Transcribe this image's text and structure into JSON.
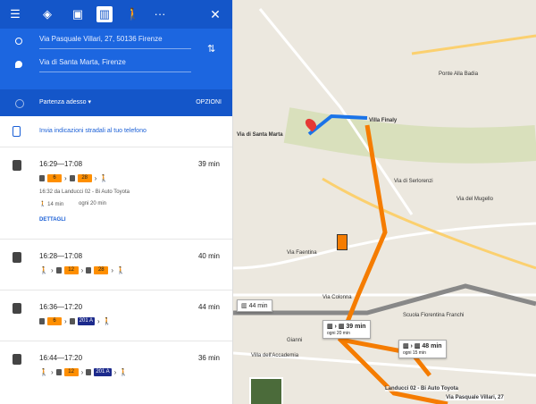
{
  "form": {
    "origin": "Via Pasquale Villari, 27, 50136 Firenze",
    "destination": "Via di Santa Marta, Firenze",
    "departure": "Partenza adesso",
    "options": "OPZIONI"
  },
  "send_to_phone": "Invia indicazioni stradali al tuo telefono",
  "routes": [
    {
      "time": "16:29—17:08",
      "duration": "39 min",
      "lines": [
        "6",
        "28"
      ],
      "details_stop": "16:32 da Landucci 02 - Bi Auto Toyota",
      "walk": "14 min",
      "every": "ogni 20 min",
      "details_link": "DETTAGLI"
    },
    {
      "time": "16:28—17:08",
      "duration": "40 min",
      "lines": [
        "12",
        "28"
      ]
    },
    {
      "time": "16:36—17:20",
      "duration": "44 min",
      "lines": [
        "6",
        "201 A"
      ]
    },
    {
      "time": "16:44—17:20",
      "duration": "36 min",
      "lines": [
        "12",
        "201 A"
      ]
    }
  ],
  "map": {
    "dest_label": "Via di Santa Marta",
    "villa": "Villa Finaly",
    "ponte": "Ponte Alla Badia",
    "c1_time": "39 min",
    "c1_sub": "ogni 20 min",
    "c2_time": "48 min",
    "c2_sub": "ogni 15 min",
    "c3_time": "44 min",
    "origin_label": "Via Pasquale Villari, 27",
    "landucci": "Landucci 02 - Bi Auto Toyota",
    "gianni": "Gianni",
    "scuola": "Scuola Fiorentina Franchi",
    "accademia": "Villa dell'Accademia",
    "colonna": "Via Colonna",
    "faentina": "Via Faentina",
    "serlorenzi": "Via di Serlorenzi",
    "mugello": "Via del Mugello"
  },
  "colors": {
    "accent": "#1c66e0",
    "route_orange": "#f57c00",
    "route_blue": "#1a73e8"
  }
}
